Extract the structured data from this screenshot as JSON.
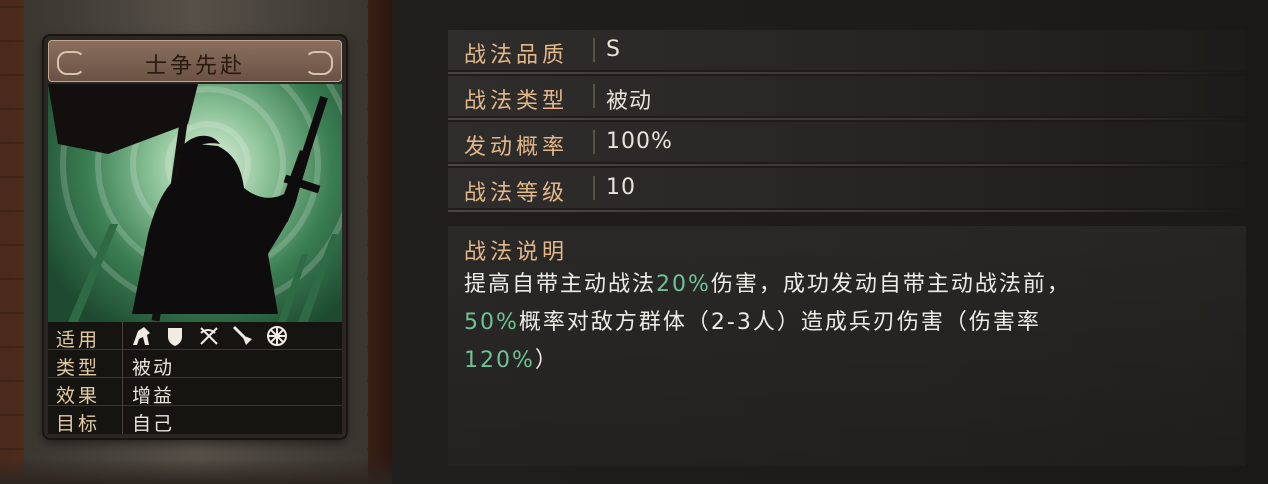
{
  "card": {
    "title": "士争先赴",
    "info": [
      {
        "key": "适用"
      },
      {
        "key": "类型",
        "value": "被动"
      },
      {
        "key": "效果",
        "value": "增益"
      },
      {
        "key": "目标",
        "value": "自己"
      }
    ],
    "unit_icons": [
      "cavalry-icon",
      "shield-icon",
      "crossed-bows-icon",
      "spear-icon",
      "wheel-icon"
    ]
  },
  "attributes": [
    {
      "key": "战法品质",
      "value": "S"
    },
    {
      "key": "战法类型",
      "value": "被动"
    },
    {
      "key": "发动概率",
      "value": "100%"
    },
    {
      "key": "战法等级",
      "value": "10"
    }
  ],
  "description": {
    "title": "战法说明",
    "parts": {
      "p1": "提高自带主动战法",
      "p2": "20%",
      "p3": "伤害，成功发动自带主动战法前，",
      "p4": "50%",
      "p5": "概率对敌方群体（2-3人）造成兵刃伤害（伤害率",
      "p6": "120%",
      "p7": "）"
    }
  },
  "colors": {
    "accent_label": "#e2b78a",
    "highlight_value": "#6fc295",
    "text": "#ecebe6"
  }
}
